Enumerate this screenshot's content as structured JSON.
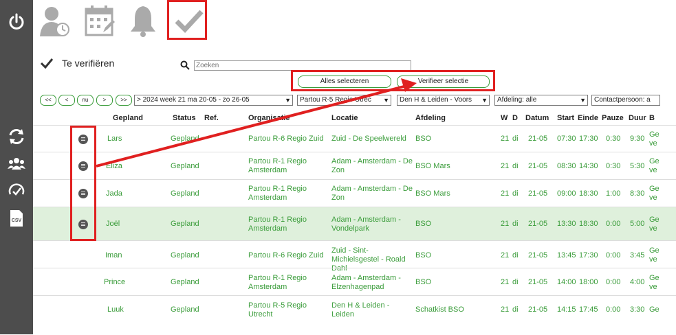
{
  "sidebar": {
    "icons": [
      "power-icon",
      "refresh-icon",
      "users-icon",
      "speed-check-icon",
      "csv-icon"
    ],
    "csv_label": "CSV"
  },
  "top_icons": [
    "user-clock-icon",
    "calendar-edit-icon",
    "bell-icon",
    "checkmark-icon"
  ],
  "page": {
    "title": "Te verifiëren"
  },
  "search": {
    "placeholder": "Zoeken"
  },
  "actions": {
    "select_all": "Alles selecteren",
    "verify_selection": "Verifieer selectie"
  },
  "nav": {
    "first": "<<",
    "prev": "<",
    "now": "nu",
    "next": ">",
    "last": ">>"
  },
  "filters": {
    "week": "> 2024 week 21  ma 20-05  -  zo 26-05",
    "organisation": "Partou R-5 Regio Utrec",
    "location": "Den H & Leiden - Voors",
    "department": "Afdeling: alle",
    "contact": "Contactpersoon: a"
  },
  "columns": [
    "Gepland",
    "Status",
    "Ref.",
    "Organisatie",
    "Locatie",
    "Afdeling",
    "W",
    "D",
    "Datum",
    "Start",
    "Einde",
    "Pauze",
    "Duur",
    "B"
  ],
  "rows": [
    {
      "name": "Lars",
      "status": "Gepland",
      "ref": "",
      "org": "Partou R-6 Regio Zuid",
      "loc": "Zuid - De Speelwereld",
      "dept": "BSO",
      "w": "21",
      "d": "di",
      "date": "21-05",
      "start": "07:30",
      "end": "17:30",
      "pause": "0:30",
      "dur": "9:30",
      "extra": "Ge ve"
    },
    {
      "name": "Eliza",
      "status": "Gepland",
      "ref": "",
      "org": "Partou R-1 Regio Amsterdam",
      "loc": "Adam - Amsterdam - De Zon",
      "dept": "BSO Mars",
      "w": "21",
      "d": "di",
      "date": "21-05",
      "start": "08:30",
      "end": "14:30",
      "pause": "0:30",
      "dur": "5:30",
      "extra": "Ge ve"
    },
    {
      "name": "Jada",
      "status": "Gepland",
      "ref": "",
      "org": "Partou R-1 Regio Amsterdam",
      "loc": "Adam - Amsterdam - De Zon",
      "dept": "BSO Mars",
      "w": "21",
      "d": "di",
      "date": "21-05",
      "start": "09:00",
      "end": "18:30",
      "pause": "1:00",
      "dur": "8:30",
      "extra": "Ge ve"
    },
    {
      "name": "Joël",
      "status": "Gepland",
      "ref": "",
      "org": "Partou R-1 Regio Amsterdam",
      "loc": "Adam - Amsterdam - Vondelpark",
      "dept": "BSO",
      "w": "21",
      "d": "di",
      "date": "21-05",
      "start": "13:30",
      "end": "18:30",
      "pause": "0:00",
      "dur": "5:00",
      "extra": "Ge ve"
    },
    {
      "name": "Iman",
      "status": "Gepland",
      "ref": "",
      "org": "Partou R-6 Regio Zuid",
      "loc": "Zuid - Sint-Michielsgestel - Roald Dahl",
      "dept": "BSO",
      "w": "21",
      "d": "di",
      "date": "21-05",
      "start": "13:45",
      "end": "17:30",
      "pause": "0:00",
      "dur": "3:45",
      "extra": "Ge ve"
    },
    {
      "name": "Prince",
      "status": "Gepland",
      "ref": "",
      "org": "Partou R-1 Regio Amsterdam",
      "loc": "Adam - Amsterdam - Elzenhagenpad",
      "dept": "BSO",
      "w": "21",
      "d": "di",
      "date": "21-05",
      "start": "14:00",
      "end": "18:00",
      "pause": "0:00",
      "dur": "4:00",
      "extra": "Ge ve"
    },
    {
      "name": "Luuk",
      "status": "Gepland",
      "ref": "",
      "org": "Partou R-5 Regio Utrecht",
      "loc": "Den H & Leiden - Leiden",
      "dept": "Schatkist BSO",
      "w": "21",
      "d": "di",
      "date": "21-05",
      "start": "14:15",
      "end": "17:45",
      "pause": "0:00",
      "dur": "3:30",
      "extra": "Ge"
    }
  ],
  "colors": {
    "sidebar": "#4d4d4d",
    "accent_green": "#3a9c3a",
    "highlight_row": "#dff0dc",
    "annotation_red": "#e02020"
  }
}
